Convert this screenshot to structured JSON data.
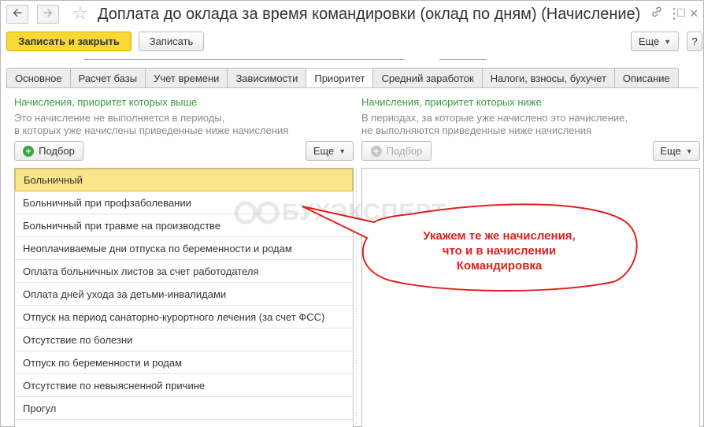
{
  "window": {
    "title": "Доплата до оклада за время командировки (оклад по дням) (Начисление)",
    "back_icon": "arrow-left-icon",
    "forward_icon": "arrow-right-icon",
    "favorite_icon": "star-icon",
    "link_icon": "link-icon",
    "menu_icon": "more-vertical-icon",
    "maximize_icon": "maximize-icon",
    "close_icon": "close-icon"
  },
  "toolbar": {
    "save_close_label": "Записать и закрыть",
    "save_label": "Записать",
    "more_label": "Еще",
    "help_label": "?"
  },
  "tabs": [
    {
      "label": "Основное"
    },
    {
      "label": "Расчет базы"
    },
    {
      "label": "Учет времени"
    },
    {
      "label": "Зависимости"
    },
    {
      "label": "Приоритет",
      "active": true
    },
    {
      "label": "Средний заработок"
    },
    {
      "label": "Налоги, взносы, бухучет"
    },
    {
      "label": "Описание"
    }
  ],
  "left_panel": {
    "title": "Начисления, приоритет которых выше",
    "desc_line1": "Это начисление не выполняется в периоды,",
    "desc_line2": "в которых уже начислены приведенные ниже начисления",
    "pick_label": "Подбор",
    "more_label": "Еще",
    "items": [
      "Больничный",
      "Больничный при профзаболевании",
      "Больничный при травме на производстве",
      "Неоплачиваемые дни отпуска по беременности и родам",
      "Оплата больничных листов за счет работодателя",
      "Оплата дней ухода за детьми-инвалидами",
      "Отпуск на период санаторно-курортного лечения (за счет ФСС)",
      "Отсутствие по болезни",
      "Отпуск по беременности и родам",
      "Отсутствие по невыясненной причине",
      "Прогул"
    ]
  },
  "right_panel": {
    "title": "Начисления, приоритет которых ниже",
    "desc_line1": "В периодах, за которые уже начислено это начисление,",
    "desc_line2": "не выполняются приведенные ниже начисления",
    "pick_label": "Подбор",
    "more_label": "Еще"
  },
  "watermark": {
    "text": "БУХЭКСПЕРТ"
  },
  "callout": {
    "line1": "Укажем те же начисления,",
    "line2": "что и в начислении",
    "line3": "Командировка",
    "color": "#e0201b"
  },
  "colors": {
    "primary_button": "#f7d835",
    "selected_row": "#fbe58a",
    "panel_title": "#3a9a3a"
  }
}
